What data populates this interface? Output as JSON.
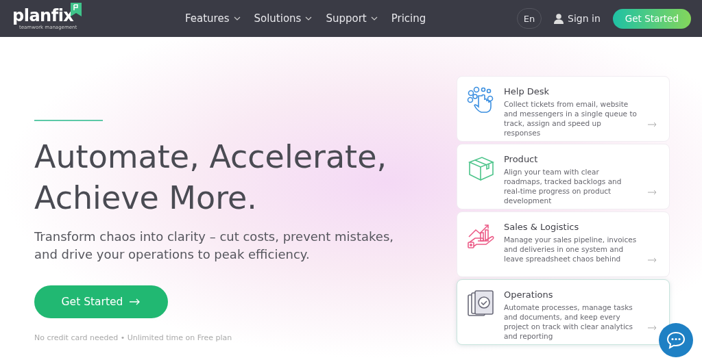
{
  "header": {
    "logo": {
      "name": "planfix",
      "tagline": "teamwork management"
    },
    "nav": [
      {
        "label": "Features",
        "dropdown": true
      },
      {
        "label": "Solutions",
        "dropdown": true
      },
      {
        "label": "Support",
        "dropdown": true
      },
      {
        "label": "Pricing",
        "dropdown": false
      }
    ],
    "language": "En",
    "sign_in": "Sign in",
    "cta": "Get Started"
  },
  "hero": {
    "headline_lines": [
      "Automate, Accelerate,",
      "Achieve More."
    ],
    "subtitle": "Transform chaos into clarity – cut costs, prevent mistakes, and drive your operations to peak efficiency.",
    "button": "Get Started",
    "note": "No credit card needed • Unlimited time on Free plan"
  },
  "solutions": [
    {
      "title": "Help Desk",
      "description": "Collect tickets from email, website and messengers in a single queue to track, assign and speed up responses",
      "highlighted": false
    },
    {
      "title": "Product",
      "description": "Align your team with clear roadmaps, tracked backlogs and real-time progress on product development",
      "highlighted": false
    },
    {
      "title": "Sales & Logistics",
      "description": "Manage your sales pipeline, invoices and deliveries in one system and leave spreadsheet chaos behind",
      "highlighted": false
    },
    {
      "title": "Operations",
      "description": "Automate processes, manage tasks and documents, and keep every project on track with clear analytics and reporting",
      "highlighted": true
    }
  ]
}
